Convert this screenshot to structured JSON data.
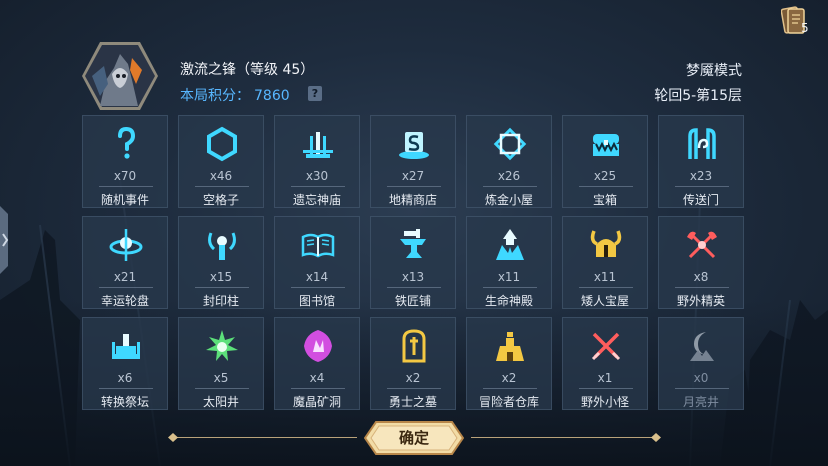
{
  "player": {
    "name_level": "激流之锋（等级 45）",
    "score_label": "本局积分：",
    "score_value": "7860",
    "help_icon": "question-icon"
  },
  "run": {
    "mode": "梦魇模式",
    "progress": "轮回5-第15层"
  },
  "deck": {
    "count": "5",
    "icon": "card-deck-icon"
  },
  "rooms": [
    {
      "icon": "question-mark-icon",
      "count": "x70",
      "name": "随机事件"
    },
    {
      "icon": "hexagon-icon",
      "count": "x46",
      "name": "空格子"
    },
    {
      "icon": "temple-icon",
      "count": "x30",
      "name": "遗忘神庙"
    },
    {
      "icon": "shop-s-icon",
      "count": "x27",
      "name": "地精商店"
    },
    {
      "icon": "alchemy-diamond-icon",
      "count": "x26",
      "name": "炼金小屋"
    },
    {
      "icon": "treasure-chest-icon",
      "count": "x25",
      "name": "宝箱"
    },
    {
      "icon": "portal-icon",
      "count": "x23",
      "name": "传送门"
    },
    {
      "icon": "wheel-icon",
      "count": "x21",
      "name": "幸运轮盘"
    },
    {
      "icon": "seal-pillar-icon",
      "count": "x15",
      "name": "封印柱"
    },
    {
      "icon": "open-book-icon",
      "count": "x14",
      "name": "图书馆"
    },
    {
      "icon": "anvil-icon",
      "count": "x13",
      "name": "铁匠铺"
    },
    {
      "icon": "life-shrine-icon",
      "count": "x11",
      "name": "生命神殿"
    },
    {
      "icon": "viking-helmet-icon",
      "count": "x11",
      "name": "矮人宝屋"
    },
    {
      "icon": "crossed-axes-icon",
      "count": "x8",
      "name": "野外精英"
    },
    {
      "icon": "altar-icon",
      "count": "x6",
      "name": "转换祭坛"
    },
    {
      "icon": "sun-icon",
      "count": "x5",
      "name": "太阳井"
    },
    {
      "icon": "crystal-icon",
      "count": "x4",
      "name": "魔晶矿洞"
    },
    {
      "icon": "tombstone-icon",
      "count": "x2",
      "name": "勇士之墓"
    },
    {
      "icon": "warehouse-icon",
      "count": "x2",
      "name": "冒险者仓库"
    },
    {
      "icon": "crossed-swords-icon",
      "count": "x1",
      "name": "野外小怪"
    },
    {
      "icon": "moon-icon",
      "count": "x0",
      "name": "月亮井"
    }
  ],
  "confirm_label": "确定",
  "colors": {
    "accent": "#3fd8ff",
    "score": "#58b7ff",
    "gold": "#e9c77a"
  }
}
